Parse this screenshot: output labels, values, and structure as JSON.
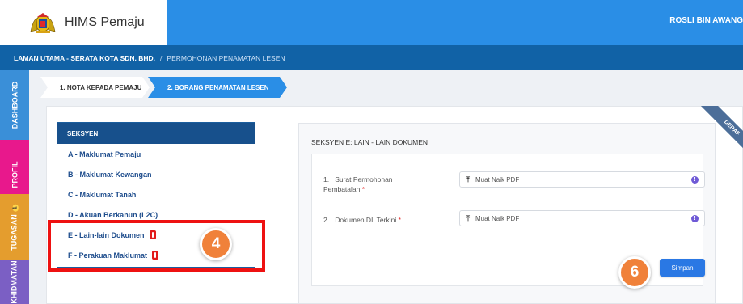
{
  "header": {
    "app_title": "HIMS Pemaju",
    "user_name": "ROSLI BIN AWANG"
  },
  "breadcrumb": {
    "home": "LAMAN UTAMA - SERATA KOTA SDN. BHD.",
    "separator": "/",
    "current": "PERMOHONAN PENAMATAN LESEN"
  },
  "sidebar": {
    "items": [
      {
        "label": "DASHBOARD",
        "color": "#3a8fd8"
      },
      {
        "label": "PROFIL",
        "color": "#e8188c"
      },
      {
        "label": "TUGASAN",
        "badge": "1",
        "color": "#e49d2e"
      },
      {
        "label": "KHIDMATAN",
        "color": "#7b5fc4"
      }
    ]
  },
  "steps": [
    {
      "label": "1. NOTA KEPADA PEMAJU",
      "active": false
    },
    {
      "label": "2. BORANG PENAMATAN LESEN",
      "active": true
    }
  ],
  "sections": {
    "heading": "SEKSYEN",
    "items": [
      {
        "label": "A - Maklumat Pemaju",
        "warning": false
      },
      {
        "label": "B - Maklumat Kewangan",
        "warning": false
      },
      {
        "label": "C - Maklumat Tanah",
        "warning": false
      },
      {
        "label": "D - Akuan Berkanun (L2C)",
        "warning": false
      },
      {
        "label": "E - Lain-lain Dokumen",
        "warning": true
      },
      {
        "label": "F - Perakuan Maklumat",
        "warning": true
      }
    ]
  },
  "form": {
    "title": "SEKSYEN E: LAIN - LAIN DOKUMEN",
    "fields": [
      {
        "number": "1.",
        "label": "Surat Permohonan Pembatalan",
        "required_mark": "*",
        "upload_label": "Muat Naik PDF"
      },
      {
        "number": "2.",
        "label": "Dokumen DL Terkini",
        "required_mark": "*",
        "upload_label": "Muat Naik PDF"
      }
    ],
    "save_label": "Simpan"
  },
  "ribbon": "DERAF",
  "annotations": {
    "callout_sections": "4",
    "callout_save": "6"
  },
  "colors": {
    "primary": "#2a8ee6",
    "navy": "#17508c",
    "warning": "#e21c1c",
    "highlight": "#ee1111",
    "callout": "#f0813a"
  }
}
